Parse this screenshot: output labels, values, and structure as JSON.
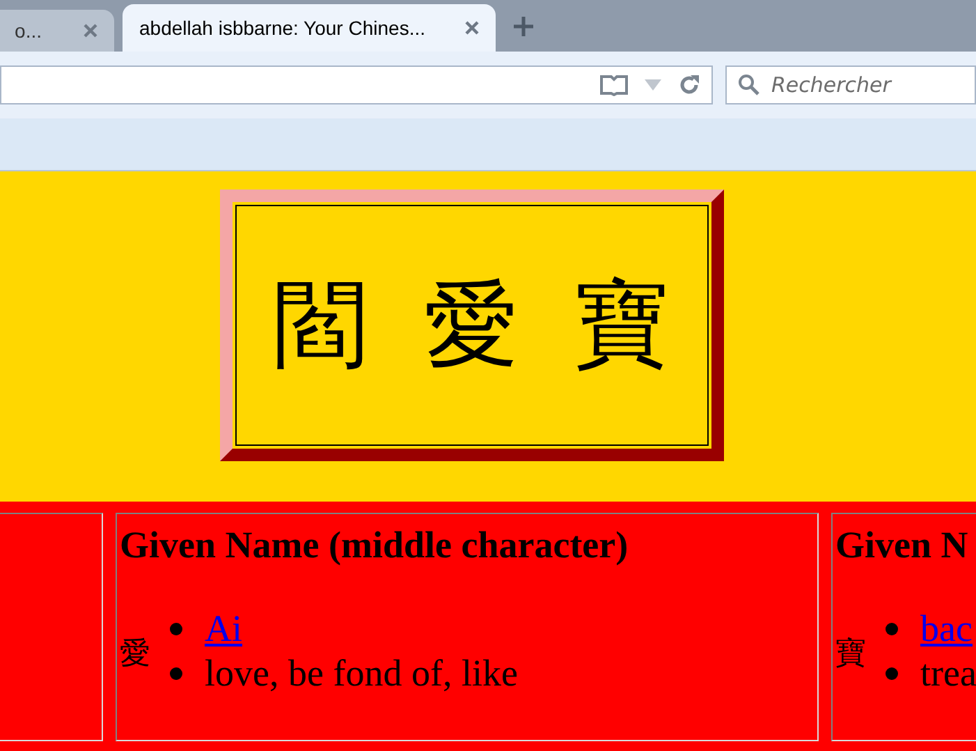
{
  "browser": {
    "tabs": [
      {
        "title": "o...",
        "selected": false
      },
      {
        "title": "abdellah isbbarne: Your Chines...",
        "selected": true
      }
    ],
    "search": {
      "placeholder": "Rechercher"
    }
  },
  "banner": {
    "characters": [
      "閻",
      "愛",
      "寶"
    ]
  },
  "cells": [
    {},
    {
      "heading": "Given Name (middle character)",
      "character": "愛",
      "items": [
        {
          "kind": "link",
          "text": "Ai"
        },
        {
          "kind": "text",
          "text": "love, be fond of, like"
        }
      ]
    },
    {
      "heading": "Given N",
      "character": "寶",
      "items": [
        {
          "kind": "link",
          "text": "bac"
        },
        {
          "kind": "text",
          "text": "trea"
        }
      ]
    }
  ]
}
